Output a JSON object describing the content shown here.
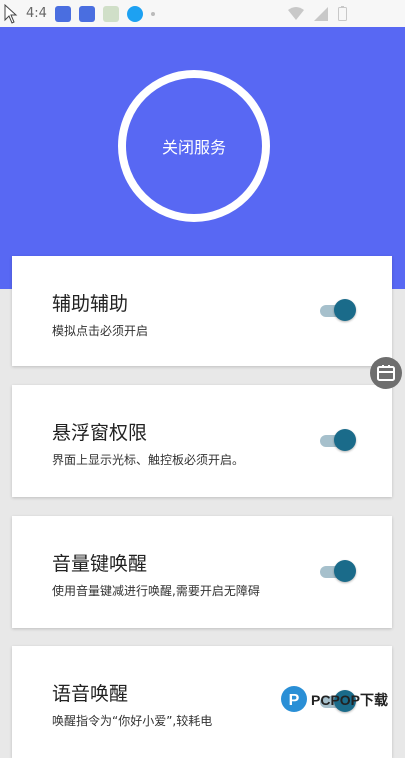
{
  "status_bar": {
    "time": "4:4"
  },
  "hero": {
    "service_button_label": "关闭服务"
  },
  "cards": [
    {
      "title": "辅助辅助",
      "description": "模拟点击必须开启",
      "enabled": true
    },
    {
      "title": "悬浮窗权限",
      "description": "界面上显示光标、触控板必须开启。",
      "enabled": true
    },
    {
      "title": "音量键唤醒",
      "description": "使用音量键减进行唤醒,需要开启无障碍",
      "enabled": true
    },
    {
      "title": "语音唤醒",
      "description": "唤醒指令为“你好小爱”,较耗电",
      "enabled": true
    }
  ],
  "watermark": {
    "text": "PCPOP下载"
  },
  "colors": {
    "hero": "#5868f3",
    "toggle_on": "#1a6b8a",
    "toggle_track": "#a6c0cc"
  }
}
